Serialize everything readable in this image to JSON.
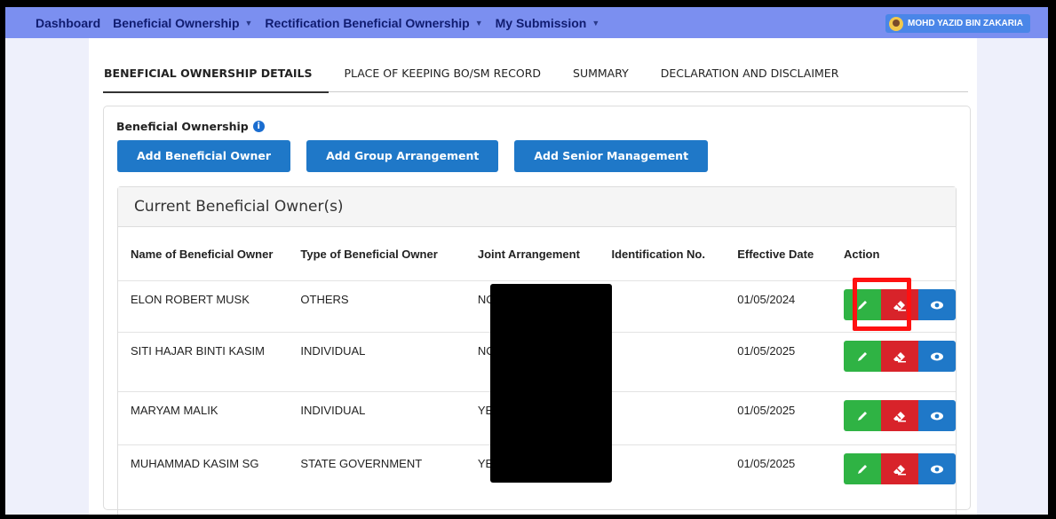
{
  "navbar": {
    "items": [
      {
        "label": "Dashboard",
        "dropdown": false
      },
      {
        "label": "Beneficial Ownership",
        "dropdown": true
      },
      {
        "label": "Rectification Beneficial Ownership",
        "dropdown": true
      },
      {
        "label": "My Submission",
        "dropdown": true
      }
    ],
    "user_name": "MOHD YAZID BIN ZAKARIA"
  },
  "tabs": [
    {
      "label": "BENEFICIAL OWNERSHIP DETAILS",
      "active": true
    },
    {
      "label": "PLACE OF KEEPING BO/SM RECORD",
      "active": false
    },
    {
      "label": "SUMMARY",
      "active": false
    },
    {
      "label": "DECLARATION AND DISCLAIMER",
      "active": false
    }
  ],
  "section": {
    "label": "Beneficial Ownership",
    "buttons": [
      "Add Beneficial Owner",
      "Add Group Arrangement",
      "Add Senior Management"
    ]
  },
  "panel": {
    "title": "Current Beneficial Owner(s)",
    "columns": [
      "Name of Beneficial Owner",
      "Type of Beneficial Owner",
      "Joint Arrangement",
      "Identification No.",
      "Effective Date",
      "Action"
    ],
    "rows": [
      {
        "name": "ELON ROBERT MUSK",
        "type": "OTHERS",
        "joint": "NO",
        "id_no": "",
        "date": "01/05/2024"
      },
      {
        "name": "SITI HAJAR BINTI KASIM",
        "type": "INDIVIDUAL",
        "joint": "NO",
        "id_no": "",
        "date": "01/05/2025"
      },
      {
        "name": "MARYAM MALIK",
        "type": "INDIVIDUAL",
        "joint": "YES",
        "id_no": "",
        "date": "01/05/2025"
      },
      {
        "name": "MUHAMMAD KASIM SG",
        "type": "STATE GOVERNMENT",
        "joint": "YES",
        "id_no": "",
        "date": "01/05/2025"
      }
    ]
  },
  "colors": {
    "navbar": "#7b8ff0",
    "primary": "#1f78c8",
    "edit": "#2fb344",
    "delete": "#d8232a",
    "highlight": "#ff1111"
  },
  "icons": {
    "edit": "pencil-icon",
    "delete": "eraser-icon",
    "view": "eye-icon",
    "info": "info-icon",
    "dropdown": "caret-down-icon"
  }
}
